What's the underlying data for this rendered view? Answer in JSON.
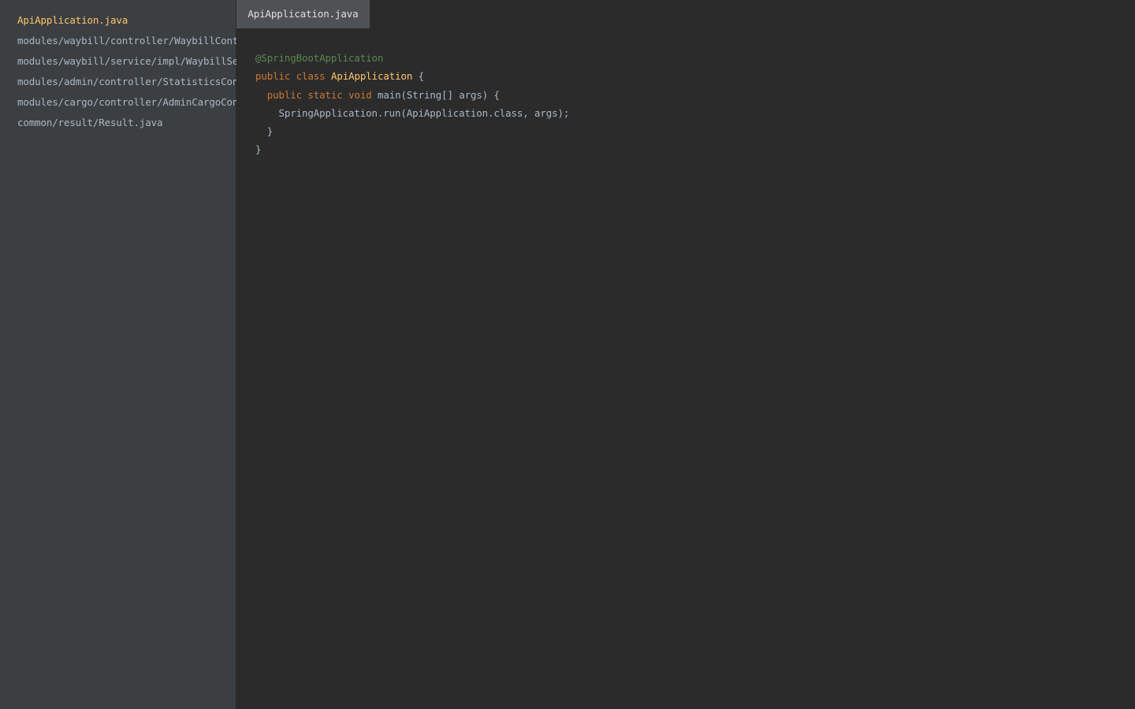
{
  "sidebar": {
    "files": [
      {
        "label": "ApiApplication.java",
        "active": true
      },
      {
        "label": "modules/waybill/controller/WaybillController.java",
        "active": false
      },
      {
        "label": "modules/waybill/service/impl/WaybillServiceImpl.java",
        "active": false
      },
      {
        "label": "modules/admin/controller/StatisticsController.java",
        "active": false
      },
      {
        "label": "modules/cargo/controller/AdminCargoController.java",
        "active": false
      },
      {
        "label": "common/result/Result.java",
        "active": false
      }
    ]
  },
  "tabs": [
    {
      "label": "ApiApplication.java",
      "active": true
    }
  ],
  "editor": {
    "annotation": "@SpringBootApplication",
    "line2": {
      "kw1": "public",
      "kw2": "class",
      "name": "ApiApplication",
      "rest": " {"
    },
    "line3": {
      "indent": "  ",
      "kw1": "public",
      "kw2": "static",
      "kw3": "void",
      "rest": " main(String[] args) {"
    },
    "line4": "    SpringApplication.run(ApiApplication.class, args);",
    "line5": "  }",
    "line6": "}"
  },
  "colors": {
    "sidebar_bg": "#3c3f41",
    "editor_bg": "#2b2b2b",
    "tab_active_bg": "#4e5254",
    "keyword": "#cc7832",
    "class_name": "#ffc66d",
    "annotation": "#629755",
    "text": "#a9b7c6"
  }
}
